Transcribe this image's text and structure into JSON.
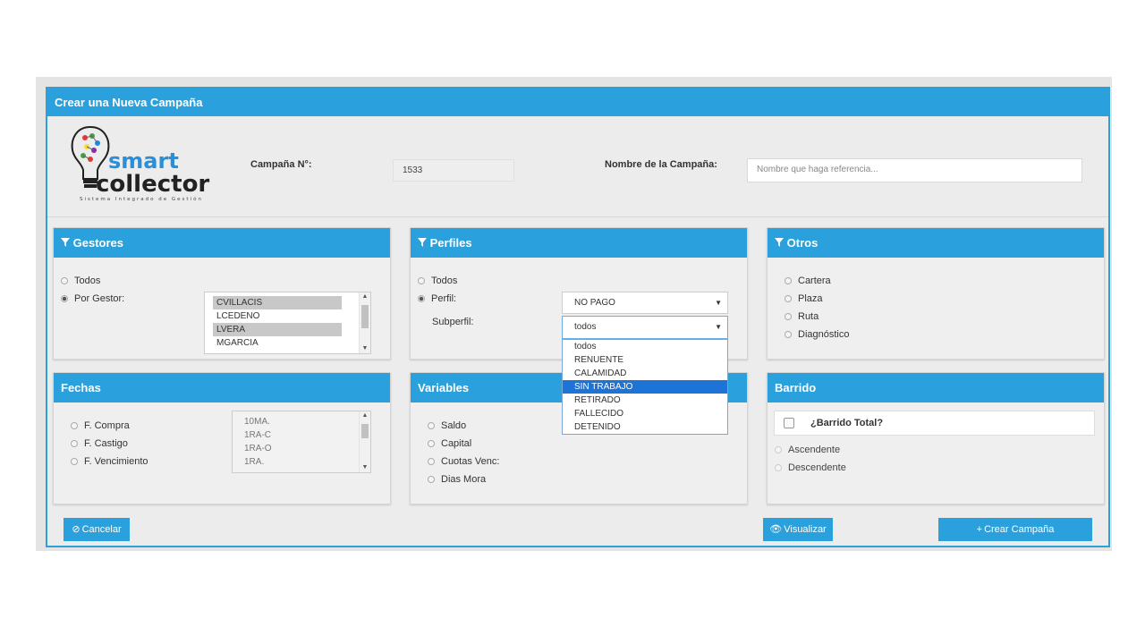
{
  "modal": {
    "title": "Crear una Nueva Campaña"
  },
  "header": {
    "logo": {
      "word1": "smart",
      "word2": "collector",
      "tagline": "Sistema Integrado de Gestión"
    },
    "campaign_no_label": "Campaña N°:",
    "campaign_no_value": "1533",
    "campaign_name_label": "Nombre de la Campaña:",
    "campaign_name_placeholder": "Nombre que haga referencia..."
  },
  "gestores": {
    "title": "Gestores",
    "opt_all": "Todos",
    "opt_by": "Por Gestor:",
    "list": [
      "CVILLACIS",
      "LCEDENO",
      "LVERA",
      "MGARCIA"
    ],
    "selected": [
      "CVILLACIS",
      "LVERA"
    ]
  },
  "perfiles": {
    "title": "Perfiles",
    "opt_all": "Todos",
    "opt_perfil": "Perfil:",
    "subperfil_label": "Subperfil:",
    "perfil_value": "NO PAGO",
    "subperfil_value": "todos",
    "subperfil_options": [
      "todos",
      "RENUENTE",
      "CALAMIDAD",
      "SIN TRABAJO",
      "RETIRADO",
      "FALLECIDO",
      "DETENIDO"
    ],
    "highlighted": "SIN TRABAJO"
  },
  "otros": {
    "title": "Otros",
    "items": [
      "Cartera",
      "Plaza",
      "Ruta",
      "Diagnóstico"
    ]
  },
  "fechas": {
    "title": "Fechas",
    "items": [
      "F. Compra",
      "F. Castigo",
      "F. Vencimiento"
    ],
    "list": [
      "10MA.",
      "1RA-C",
      "1RA-O",
      "1RA."
    ]
  },
  "variables": {
    "title": "Variables",
    "items": [
      "Saldo",
      "Capital",
      "Cuotas Venc:",
      "Dias Mora"
    ]
  },
  "barrido": {
    "title": "Barrido",
    "total_label": "¿Barrido Total?",
    "items": [
      "Ascendente",
      "Descendente"
    ]
  },
  "buttons": {
    "cancel": "Cancelar",
    "preview": "Visualizar",
    "create": "Crear Campaña"
  },
  "colors": {
    "primary": "#2aa0dc",
    "highlight": "#1e73d6"
  },
  "icons": [
    "filter-icon",
    "ban-icon",
    "eye-icon",
    "plus-icon"
  ]
}
